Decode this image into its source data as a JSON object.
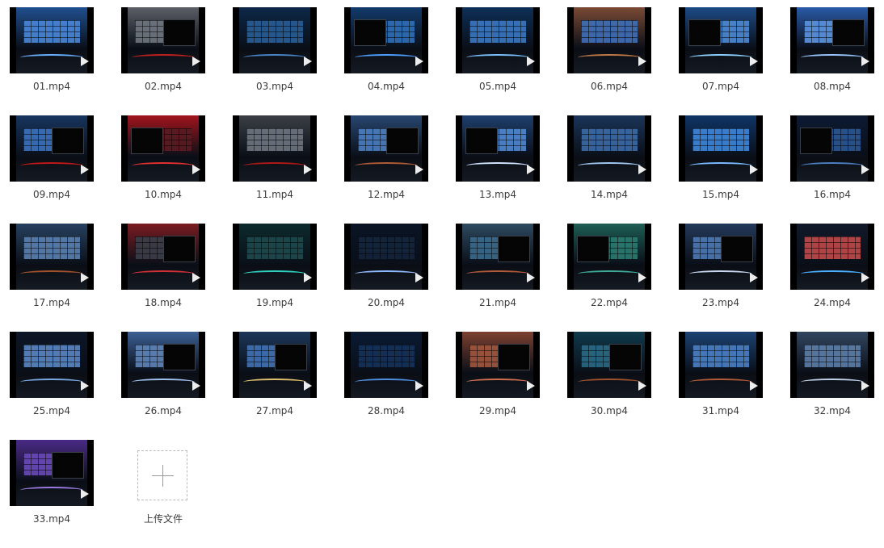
{
  "files": [
    {
      "name": "01.mp4",
      "wall": "#1f4f8f",
      "screens": "#4a86d6",
      "monitor": false,
      "accent": "#6ab0ff"
    },
    {
      "name": "02.mp4",
      "wall": "#5c5f66",
      "screens": "#6f7680",
      "monitor": true,
      "accent": "#c02020"
    },
    {
      "name": "03.mp4",
      "wall": "#0c2748",
      "screens": "#2a5e96",
      "monitor": false,
      "accent": "#4a86c6"
    },
    {
      "name": "04.mp4",
      "wall": "#123a6a",
      "screens": "#2f6fb8",
      "monitor": true,
      "accent": "#4fa0ff"
    },
    {
      "name": "05.mp4",
      "wall": "#0e2f57",
      "screens": "#3b78c2",
      "monitor": false,
      "accent": "#7cc0ff"
    },
    {
      "name": "06.mp4",
      "wall": "#7a4a34",
      "screens": "#3f6fb7",
      "monitor": false,
      "accent": "#c07a4a"
    },
    {
      "name": "07.mp4",
      "wall": "#1d4a86",
      "screens": "#4d8ad4",
      "monitor": true,
      "accent": "#8fd0ff"
    },
    {
      "name": "08.mp4",
      "wall": "#2a5aa8",
      "screens": "#5b94e0",
      "monitor": true,
      "accent": "#9cc8ff"
    },
    {
      "name": "09.mp4",
      "wall": "#17355f",
      "screens": "#3c72bd",
      "monitor": true,
      "accent": "#c01818"
    },
    {
      "name": "10.mp4",
      "wall": "#a0141c",
      "screens": "#5a1b22",
      "monitor": true,
      "accent": "#e03030"
    },
    {
      "name": "11.mp4",
      "wall": "#3b3f45",
      "screens": "#6e7580",
      "monitor": false,
      "accent": "#b01818"
    },
    {
      "name": "12.mp4",
      "wall": "#27466f",
      "screens": "#4c7ec0",
      "monitor": true,
      "accent": "#b05a3a"
    },
    {
      "name": "13.mp4",
      "wall": "#1e3f6e",
      "screens": "#4f88d0",
      "monitor": true,
      "accent": "#cfe2ff"
    },
    {
      "name": "14.mp4",
      "wall": "#1a3559",
      "screens": "#3c6aa6",
      "monitor": false,
      "accent": "#9fc5f0"
    },
    {
      "name": "15.mp4",
      "wall": "#0f3566",
      "screens": "#3f86d8",
      "monitor": false,
      "accent": "#7ab8ff"
    },
    {
      "name": "16.mp4",
      "wall": "#0c1a33",
      "screens": "#2c5794",
      "monitor": true,
      "accent": "#4a7ec0"
    },
    {
      "name": "17.mp4",
      "wall": "#27415f",
      "screens": "#5a80b0",
      "monitor": false,
      "accent": "#a0522d"
    },
    {
      "name": "18.mp4",
      "wall": "#7a1c22",
      "screens": "#3a3f4a",
      "monitor": true,
      "accent": "#d03038"
    },
    {
      "name": "19.mp4",
      "wall": "#0c2a2c",
      "screens": "#1e4a4e",
      "monitor": false,
      "accent": "#2fd0c0"
    },
    {
      "name": "20.mp4",
      "wall": "#0a1424",
      "screens": "#15253d",
      "monitor": false,
      "accent": "#8fb8ff"
    },
    {
      "name": "21.mp4",
      "wall": "#2d4a5f",
      "screens": "#3b6a8c",
      "monitor": true,
      "accent": "#b05a3a"
    },
    {
      "name": "22.mp4",
      "wall": "#1d5e55",
      "screens": "#2c7a70",
      "monitor": true,
      "accent": "#3fa898"
    },
    {
      "name": "23.mp4",
      "wall": "#23395a",
      "screens": "#4d79b4",
      "monitor": true,
      "accent": "#c8d8f0"
    },
    {
      "name": "24.mp4",
      "wall": "#111a2a",
      "screens": "#c04a4a",
      "monitor": false,
      "accent": "#4ab0ff"
    },
    {
      "name": "25.mp4",
      "wall": "#0d1626",
      "screens": "#5a86c4",
      "monitor": false,
      "accent": "#7aa8e0"
    },
    {
      "name": "26.mp4",
      "wall": "#3b5f93",
      "screens": "#5f84b8",
      "monitor": true,
      "accent": "#9fc0ec"
    },
    {
      "name": "27.mp4",
      "wall": "#1c3658",
      "screens": "#4172b4",
      "monitor": true,
      "accent": "#e0c070"
    },
    {
      "name": "28.mp4",
      "wall": "#0a1a33",
      "screens": "#16325a",
      "monitor": false,
      "accent": "#4f8fe0"
    },
    {
      "name": "29.mp4",
      "wall": "#7c4030",
      "screens": "#a0563e",
      "monitor": true,
      "accent": "#d07050"
    },
    {
      "name": "30.mp4",
      "wall": "#0f3a4c",
      "screens": "#2a6a86",
      "monitor": true,
      "accent": "#a0522d"
    },
    {
      "name": "31.mp4",
      "wall": "#1c4272",
      "screens": "#4b80c4",
      "monitor": false,
      "accent": "#b05a3a"
    },
    {
      "name": "32.mp4",
      "wall": "#31455f",
      "screens": "#5d7ea8",
      "monitor": false,
      "accent": "#c0d0e8"
    },
    {
      "name": "33.mp4",
      "wall": "#4a2a86",
      "screens": "#6a4ab8",
      "monitor": true,
      "accent": "#9a7ae0"
    }
  ],
  "upload": {
    "label": "上传文件",
    "icon": "plus-icon"
  },
  "icons": {
    "play": "play-icon"
  }
}
